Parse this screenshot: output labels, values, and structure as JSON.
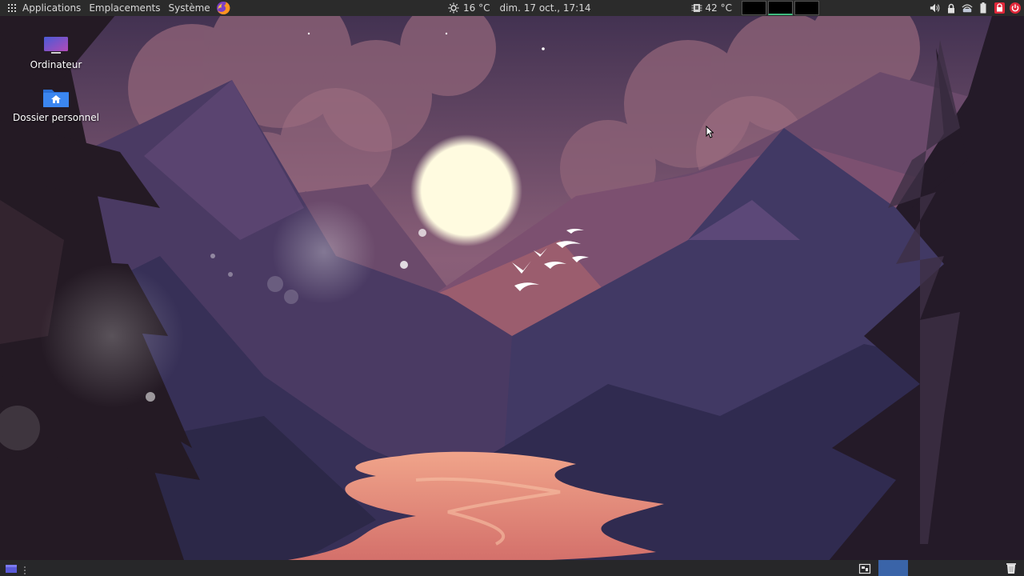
{
  "top_panel": {
    "menu": {
      "applications": "Applications",
      "places": "Emplacements",
      "system": "Système"
    },
    "weather": "16 °C",
    "datetime": "dim. 17 oct., 17:14",
    "cpu_temp": "42 °C"
  },
  "desktop": {
    "icons": [
      {
        "label": "Ordinateur",
        "icon": "computer-icon"
      },
      {
        "label": "Dossier personnel",
        "icon": "home-folder-icon"
      }
    ]
  },
  "workspaces": {
    "count": 3,
    "active": 2
  },
  "colors": {
    "panel": "#2b2b2b",
    "bottom_panel": "#272729",
    "workspace_active_indicator": "#3fb97f",
    "taskbar_active": "#3a64a8",
    "sky_top": "#3e2f4f",
    "sun": "#fdfbe2",
    "river": "#e8907a",
    "alert_red": "#e0283a"
  }
}
